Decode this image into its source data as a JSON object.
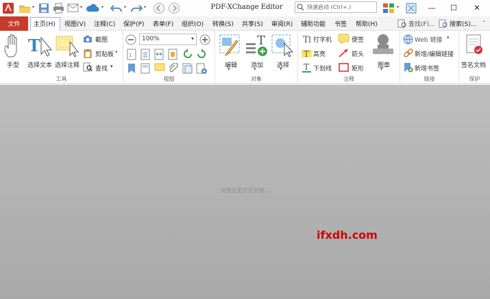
{
  "app": {
    "title": "PDF-XChange Editor",
    "search_placeholder": "快速启动 (Ctrl+.)",
    "accent": "#c73b2a"
  },
  "menubar": {
    "file": "文件",
    "items": [
      "主页(H)",
      "视图(V)",
      "注释(C)",
      "保护(P)",
      "表单(F)",
      "组织(O)",
      "转换(S)",
      "共享(S)",
      "审阅(R)",
      "辅助功能",
      "书签",
      "帮助(H)"
    ],
    "find": "查找(F)...",
    "search": "搜索(S)..."
  },
  "ribbon": {
    "tools": {
      "label": "工具",
      "hand": "手型",
      "select_text": "选择文本",
      "select_comment": "选择注释",
      "snapshot": "截图",
      "clipboard": "剪贴板",
      "find": "查找"
    },
    "view": {
      "label": "视图",
      "zoom": "100%"
    },
    "objects": {
      "label": "对象",
      "edit": "编辑",
      "add": "添加",
      "select": "选择"
    },
    "comments": {
      "label": "注释",
      "typewriter": "打字机",
      "note": "便签",
      "highlight": "高亮",
      "arrow": "箭头",
      "underline": "下划线",
      "rectangle": "矩形",
      "stamp": "图章"
    },
    "links": {
      "label": "链接",
      "web_links": "Web 链接",
      "add_edit_link": "新增/编辑链接",
      "add_bookmark": "新增书签"
    },
    "protect": {
      "label": "保护",
      "sign_document": "签名文档"
    }
  },
  "workspace": {
    "hint": "双击这里打开文档...",
    "watermark": "ifxdh.com"
  }
}
